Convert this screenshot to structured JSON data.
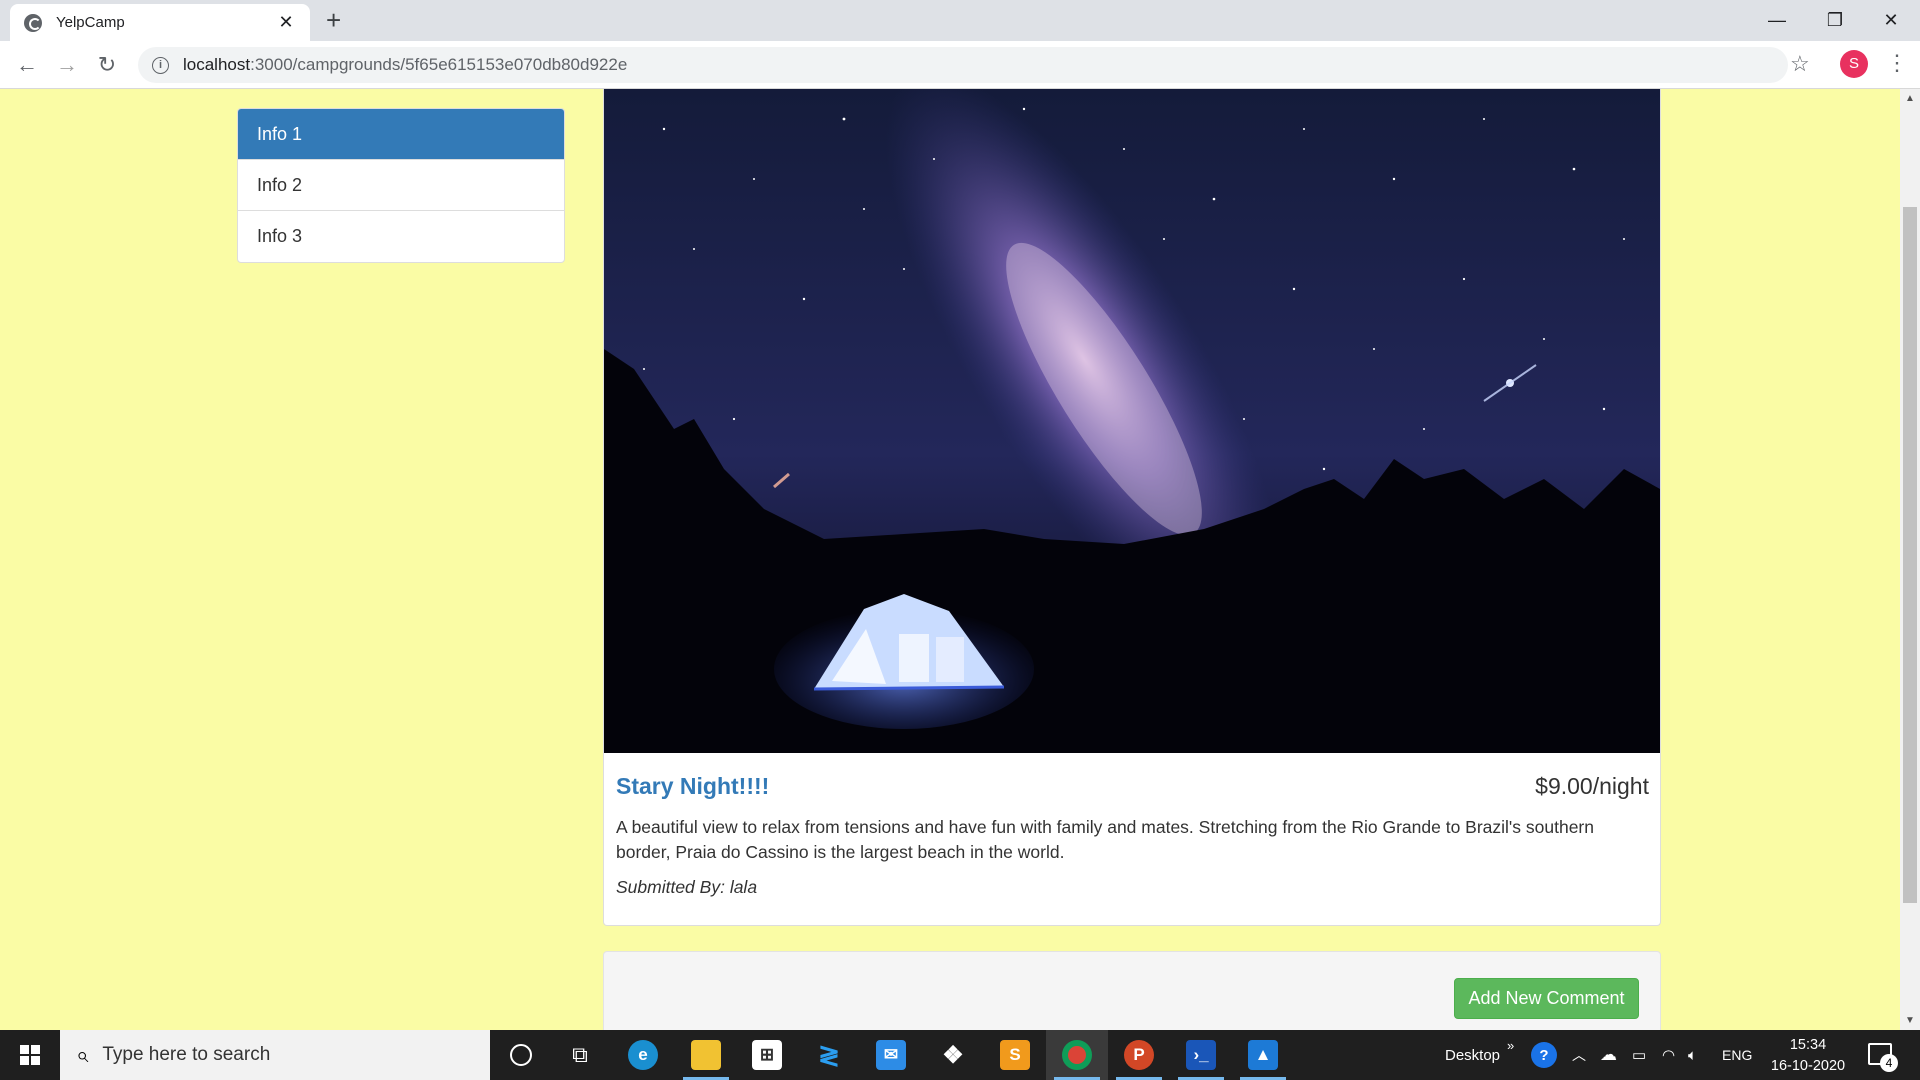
{
  "browser": {
    "tab_title": "YelpCamp",
    "url_host": "localhost",
    "url_path": ":3000/campgrounds/5f65e615153e070db80d922e",
    "profile_initial": "S"
  },
  "sidebar": {
    "items": [
      {
        "label": "Info 1",
        "active": true
      },
      {
        "label": "Info 2",
        "active": false
      },
      {
        "label": "Info 3",
        "active": false
      }
    ]
  },
  "campground": {
    "name": "Stary Night!!!!",
    "price": "$9.00/night",
    "description": "A beautiful view to relax from tensions and have fun with family and mates. Stretching from the Rio Grande to Brazil's southern border, Praia do Cassino is the largest beach in the world.",
    "submitted_prefix": "Submitted By: ",
    "author": "lala"
  },
  "comments": {
    "add_button_label": "Add New Comment"
  },
  "taskbar": {
    "search_placeholder": "Type here to search",
    "desktop_label": "Desktop",
    "language": "ENG",
    "time": "15:34",
    "date": "16-10-2020",
    "notification_count": "4"
  },
  "colors": {
    "page_background": "#fafca5",
    "link_blue": "#337ab7",
    "success_green": "#5cb85c"
  }
}
